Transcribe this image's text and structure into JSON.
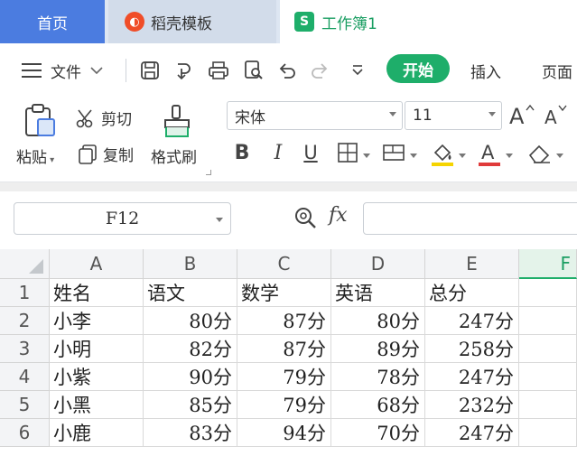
{
  "tabs": {
    "home": "首页",
    "template": "稻壳模板",
    "workbook": "工作簿1"
  },
  "menu": {
    "file": "文件",
    "start": "开始",
    "insert": "插入",
    "page": "页面"
  },
  "ribbon": {
    "paste": "粘贴",
    "cut": "剪切",
    "copy": "复制",
    "format_painter": "格式刷",
    "font_name": "宋体",
    "font_size": "11"
  },
  "formula_bar": {
    "name_box": "F12",
    "fx": "fx",
    "formula": ""
  },
  "grid": {
    "columns": [
      "A",
      "B",
      "C",
      "D",
      "E",
      "F"
    ],
    "selected_column": "F",
    "rows": [
      {
        "num": "1",
        "cells": [
          "姓名",
          "语文",
          "数学",
          "英语",
          "总分",
          ""
        ]
      },
      {
        "num": "2",
        "cells": [
          "小李",
          "80分",
          "87分",
          "80分",
          "247分",
          ""
        ]
      },
      {
        "num": "3",
        "cells": [
          "小明",
          "82分",
          "87分",
          "89分",
          "258分",
          ""
        ]
      },
      {
        "num": "4",
        "cells": [
          "小紫",
          "90分",
          "79分",
          "78分",
          "247分",
          ""
        ]
      },
      {
        "num": "5",
        "cells": [
          "小黑",
          "85分",
          "79分",
          "68分",
          "232分",
          ""
        ]
      },
      {
        "num": "6",
        "cells": [
          "小鹿",
          "83分",
          "94分",
          "70分",
          "247分",
          ""
        ]
      }
    ]
  },
  "colors": {
    "home_tab": "#4b7ce0",
    "accent_green": "#1eae6a",
    "template_logo": "#f04d28",
    "underline_red": "#e03a3a",
    "highlight_yellow": "#f5d400"
  }
}
